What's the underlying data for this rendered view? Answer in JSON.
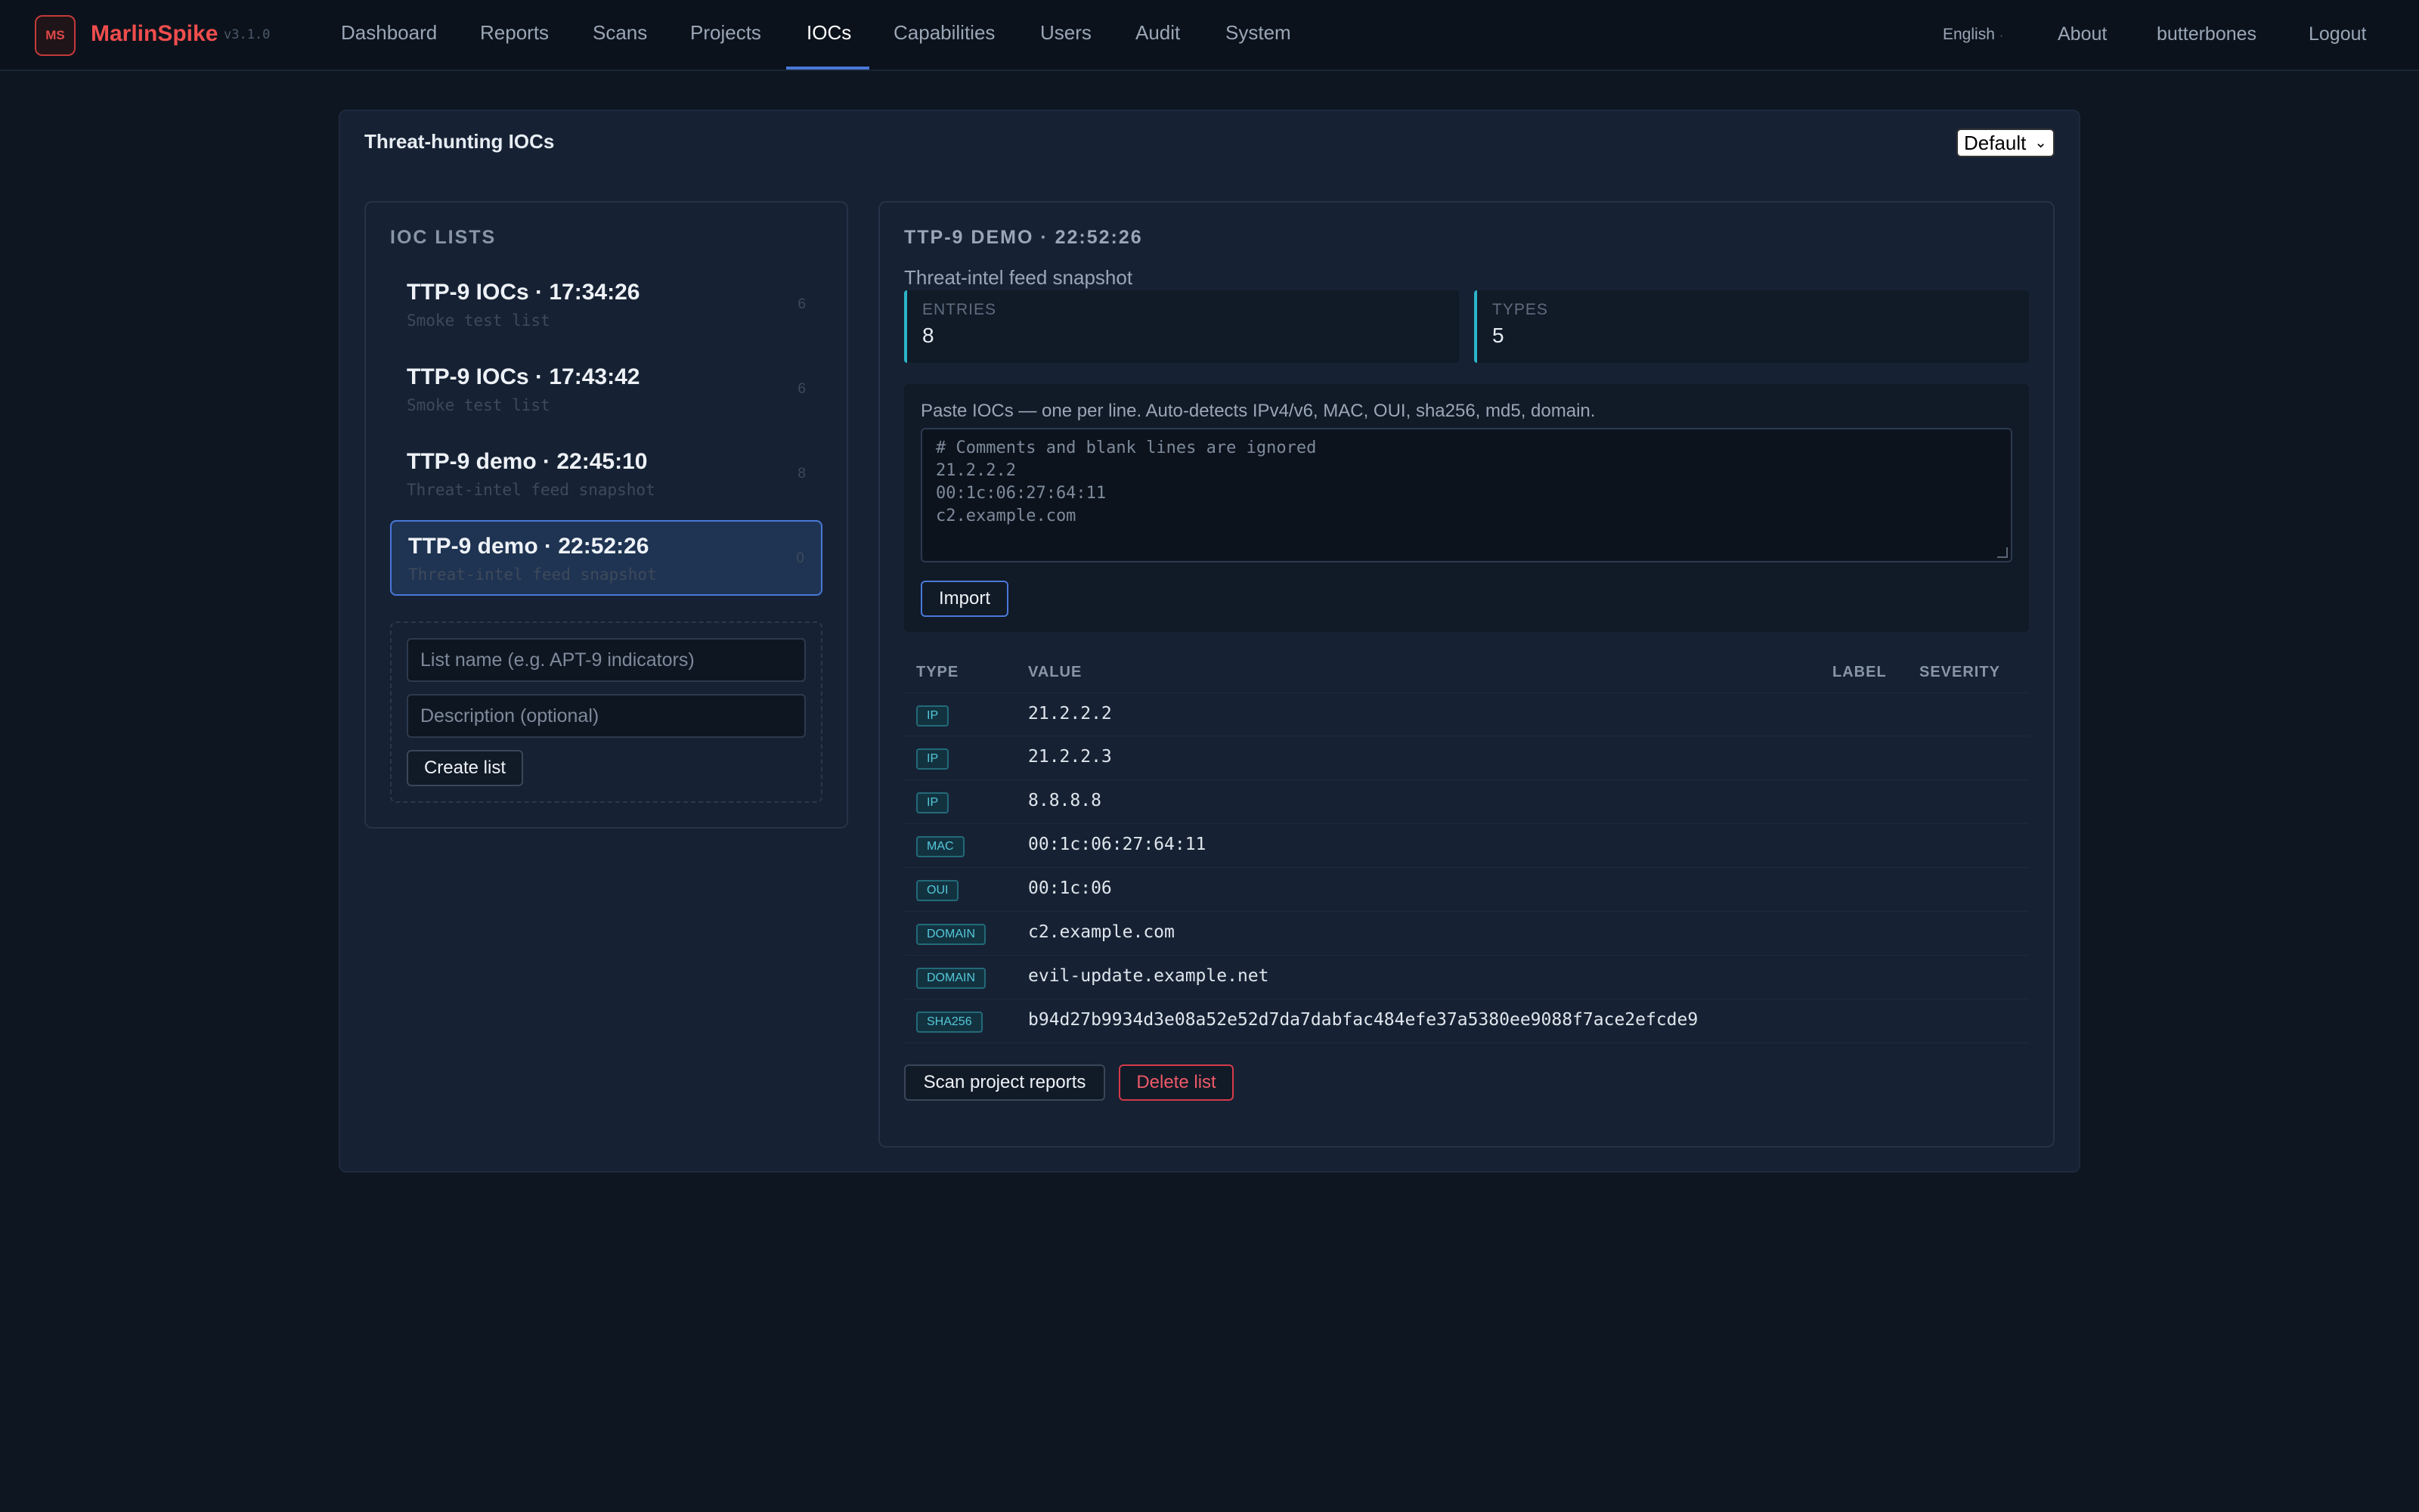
{
  "app": {
    "logo": "MS",
    "name": "MarlinSpike",
    "version": "v3.1.0"
  },
  "nav": {
    "items": [
      "Dashboard",
      "Reports",
      "Scans",
      "Projects",
      "IOCs",
      "Capabilities",
      "Users",
      "Audit",
      "System"
    ],
    "active": "IOCs"
  },
  "topright": {
    "language": "English",
    "about": "About",
    "user": "butterbones",
    "logout": "Logout"
  },
  "page": {
    "title": "Threat-hunting IOCs",
    "layout_select": "Default"
  },
  "lists": {
    "heading": "IOC LISTS",
    "items": [
      {
        "title": "TTP-9 IOCs · 17:34:26",
        "desc": "Smoke test list",
        "count": "6"
      },
      {
        "title": "TTP-9 IOCs · 17:43:42",
        "desc": "Smoke test list",
        "count": "6"
      },
      {
        "title": "TTP-9 demo · 22:45:10",
        "desc": "Threat-intel feed snapshot",
        "count": "8"
      },
      {
        "title": "TTP-9 demo · 22:52:26",
        "desc": "Threat-intel feed snapshot",
        "count": "0"
      }
    ],
    "selected_index": 3,
    "create": {
      "name_placeholder": "List name (e.g. APT-9 indicators)",
      "desc_placeholder": "Description (optional)",
      "button": "Create list"
    }
  },
  "detail": {
    "heading": "TTP-9 DEMO · 22:52:26",
    "subtitle": "Threat-intel feed snapshot",
    "stats": [
      {
        "label": "ENTRIES",
        "value": "8"
      },
      {
        "label": "TYPES",
        "value": "5"
      }
    ],
    "paste": {
      "label": "Paste IOCs — one per line. Auto-detects IPv4/v6, MAC, OUI, sha256, md5, domain.",
      "placeholder_lines": [
        "# Comments and blank lines are ignored",
        "21.2.2.2",
        "00:1c:06:27:64:11",
        "c2.example.com"
      ],
      "import_button": "Import"
    },
    "table": {
      "headers": {
        "type": "TYPE",
        "value": "VALUE",
        "label": "LABEL",
        "severity": "SEVERITY"
      },
      "rows": [
        {
          "type": "IP",
          "value": "21.2.2.2"
        },
        {
          "type": "IP",
          "value": "21.2.2.3"
        },
        {
          "type": "IP",
          "value": "8.8.8.8"
        },
        {
          "type": "MAC",
          "value": "00:1c:06:27:64:11"
        },
        {
          "type": "OUI",
          "value": "00:1c:06"
        },
        {
          "type": "DOMAIN",
          "value": "c2.example.com"
        },
        {
          "type": "DOMAIN",
          "value": "evil-update.example.net"
        },
        {
          "type": "SHA256",
          "value": "b94d27b9934d3e08a52e52d7da7dabfac484efe37a5380ee9088f7ace2efcde9"
        }
      ]
    },
    "actions": {
      "scan": "Scan project reports",
      "delete": "Delete list"
    }
  }
}
